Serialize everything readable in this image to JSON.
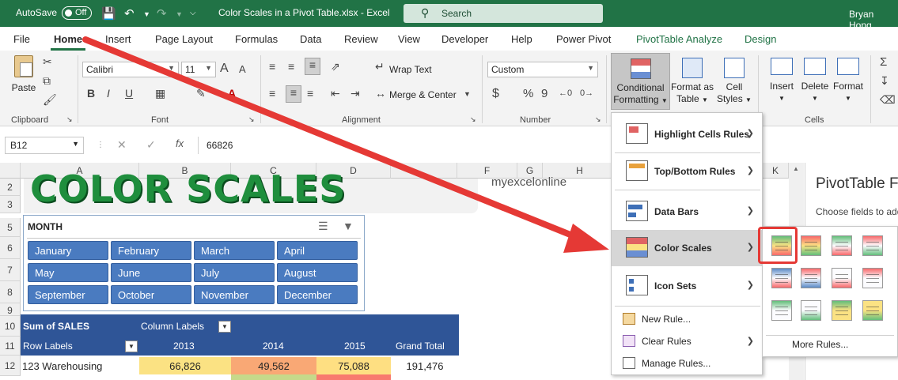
{
  "titlebar": {
    "autosave_label": "AutoSave",
    "autosave_state": "Off",
    "document": "Color Scales in a Pivot Table.xlsx  -  Excel",
    "search_placeholder": "Search",
    "user": "Bryan Hong"
  },
  "tabs": [
    "File",
    "Home",
    "Insert",
    "Page Layout",
    "Formulas",
    "Data",
    "Review",
    "View",
    "Developer",
    "Help",
    "Power Pivot",
    "PivotTable Analyze",
    "Design"
  ],
  "ribbon": {
    "clipboard": {
      "paste": "Paste",
      "label": "Clipboard"
    },
    "font": {
      "name": "Calibri",
      "size": "11",
      "bold": "B",
      "italic": "I",
      "underline": "U",
      "grow": "A",
      "shrink": "A",
      "label": "Font"
    },
    "alignment": {
      "wrap": "Wrap Text",
      "merge": "Merge & Center",
      "label": "Alignment"
    },
    "number": {
      "format": "Custom",
      "currency": "$",
      "percent": "%",
      "comma": "9",
      "label": "Number"
    },
    "styles": {
      "conditional_l1": "Conditional",
      "conditional_l2": "Formatting",
      "table_l1": "Format as",
      "table_l2": "Table",
      "cell_l1": "Cell",
      "cell_l2": "Styles"
    },
    "cells": {
      "insert": "Insert",
      "delete": "Delete",
      "format": "Format",
      "label": "Cells"
    }
  },
  "formula_bar": {
    "name_box": "B12",
    "fx": "fx",
    "value": "66826"
  },
  "columns": [
    "A",
    "B",
    "C",
    "D",
    "F",
    "G",
    "H",
    "K"
  ],
  "rows": [
    "2",
    "3",
    "5",
    "6",
    "7",
    "8",
    "9",
    "10",
    "11",
    "12"
  ],
  "sheet": {
    "banner": "COLOR SCALES",
    "logo": "myexcelonline"
  },
  "slicer": {
    "title": "MONTH",
    "months": [
      "January",
      "February",
      "March",
      "April",
      "May",
      "June",
      "July",
      "August",
      "September",
      "October",
      "November",
      "December"
    ]
  },
  "pivot": {
    "sum_label": "Sum of SALES",
    "column_labels": "Column Labels",
    "row_labels": "Row Labels",
    "years": [
      "2013",
      "2014",
      "2015"
    ],
    "grand_total": "Grand Total",
    "row": {
      "name": "123 Warehousing",
      "values": [
        "66,826",
        "49,562",
        "75,088"
      ],
      "total": "191,476"
    }
  },
  "cf_menu": {
    "items": [
      "Highlight Cells Rules",
      "Top/Bottom Rules",
      "Data Bars",
      "Color Scales",
      "Icon Sets"
    ],
    "small": [
      "New Rule...",
      "Clear Rules",
      "Manage Rules..."
    ],
    "more_rules": "More Rules..."
  },
  "pane": {
    "title": "PivotTable F",
    "desc": "Choose fields to add"
  },
  "colors": {
    "excel_green": "#217346",
    "pivot_blue": "#2f5597",
    "slicer_blue": "#4a7bc0",
    "arrow_red": "#e53935"
  }
}
